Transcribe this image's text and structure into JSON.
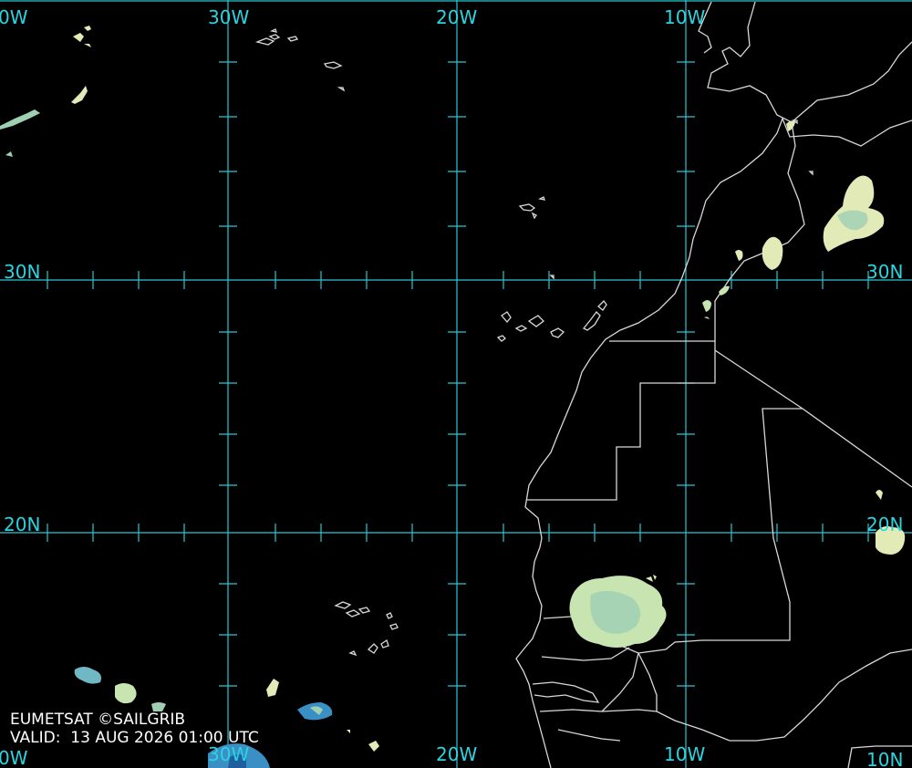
{
  "map": {
    "lon_labels_top": [
      "0W",
      "30W",
      "20W",
      "10W"
    ],
    "lon_labels_bottom": [
      "0W",
      "30W",
      "20W",
      "10W",
      "10N"
    ],
    "lat_labels": [
      {
        "text": "30N",
        "side": "left"
      },
      {
        "text": "30N",
        "side": "right"
      },
      {
        "text": "20N",
        "side": "left"
      },
      {
        "text": "20N",
        "side": "right"
      }
    ],
    "colors": {
      "background": "#000000",
      "graticule": "#29c8d4",
      "coastline": "#d8d8d8",
      "cloud_light": "#e9f0b8",
      "cloud_mid": "#9fd0b4",
      "cloud_deep": "#3a8fc4"
    }
  },
  "credit": {
    "line1": "EUMETSAT ©SAILGRIB",
    "line2": "VALID:  13 AUG 2026 01:00 UTC"
  }
}
